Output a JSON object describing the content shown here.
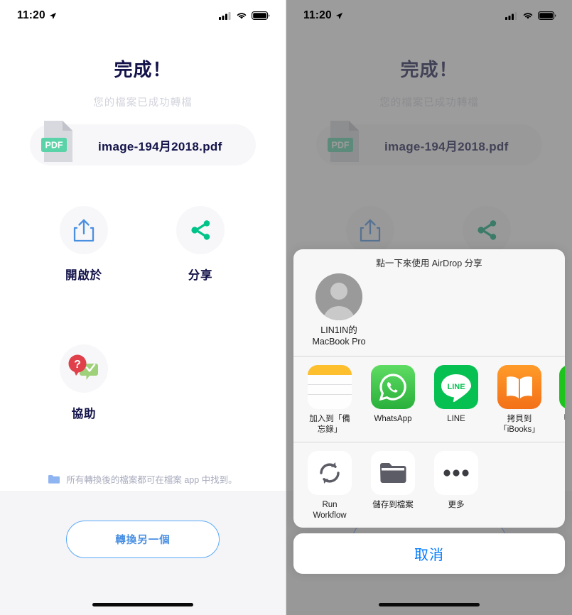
{
  "statusbar": {
    "time": "11:20",
    "location_icon": "location-arrow-icon",
    "signal_icon": "cellular-signal-icon",
    "wifi_icon": "wifi-icon",
    "battery_icon": "battery-icon"
  },
  "screen": {
    "title": "完成！",
    "subtitle": "您的檔案已成功轉檔",
    "file": {
      "name": "image-194月2018.pdf",
      "badge": "PDF",
      "icon": "pdf-file-icon"
    },
    "actions": [
      {
        "label": "開啟於",
        "icon": "open-in-share-icon"
      },
      {
        "label": "分享",
        "icon": "share-network-icon"
      },
      {
        "label": "協助",
        "icon": "help-chat-icon"
      }
    ],
    "note": {
      "icon": "folder-icon",
      "text": "所有轉換後的檔案都可在檔案 app 中找到。"
    },
    "convert_button": "轉換另一個"
  },
  "share_sheet": {
    "airdrop_title": "點一下來使用 AirDrop 分享",
    "contacts": [
      {
        "name": "LIN1IN的\nMacBook Pro",
        "avatar": "person-avatar-icon"
      }
    ],
    "apps": [
      {
        "label": "加入到「備\n忘錄」",
        "icon": "notes-app-icon"
      },
      {
        "label": "WhatsApp",
        "icon": "whatsapp-app-icon"
      },
      {
        "label": "LINE",
        "icon": "line-app-icon"
      },
      {
        "label": "拷貝到\n「iBooks」",
        "icon": "ibooks-app-icon"
      },
      {
        "label": "「",
        "icon": "wechat-app-icon"
      }
    ],
    "sheet_actions": [
      {
        "label": "Run\nWorkflow",
        "icon": "refresh-circular-icon"
      },
      {
        "label": "儲存到檔案",
        "icon": "save-to-files-folder-icon"
      },
      {
        "label": "更多",
        "icon": "more-ellipsis-icon"
      }
    ],
    "cancel_label": "取消"
  },
  "colors": {
    "title_navy": "#13134a",
    "subtitle_gray": "#d3d4de",
    "accent_blue": "#4a90e2",
    "share_green": "#00c389",
    "pdf_badge_teal": "#5ad3a8",
    "ios_blue": "#007aff"
  }
}
